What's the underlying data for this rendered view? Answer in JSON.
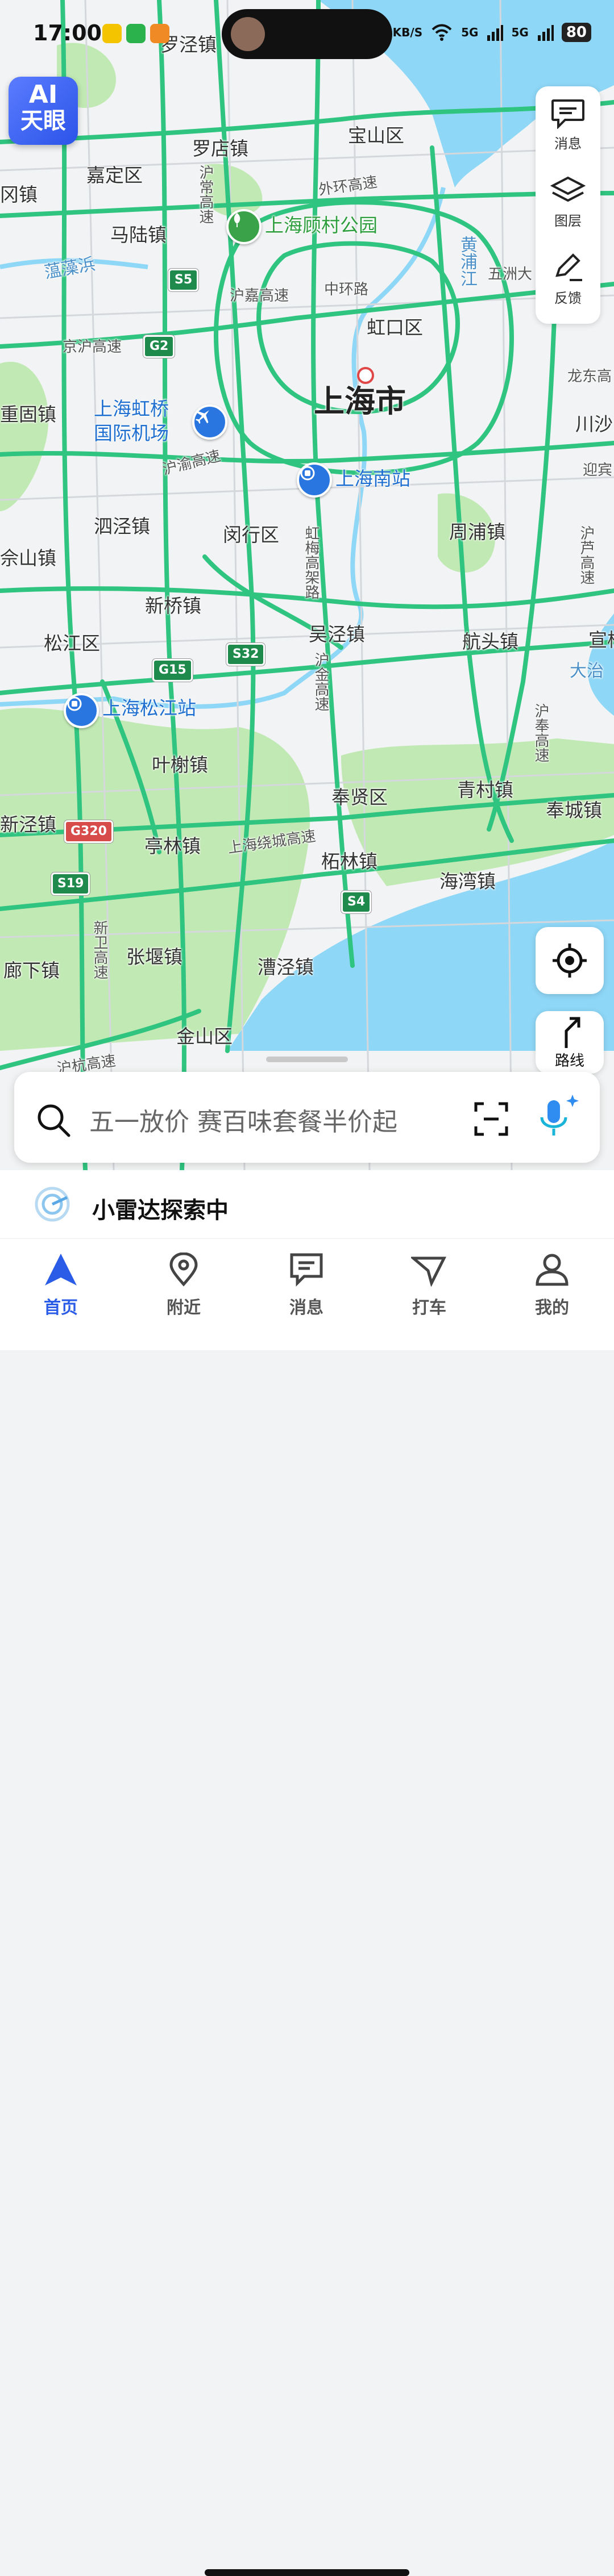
{
  "status_bar": {
    "time": "17:00",
    "speed": "180 KB/S",
    "net1": "5G",
    "net2": "5G",
    "battery": "80"
  },
  "ai_button": {
    "line1": "AI",
    "line2": "天眼"
  },
  "tools": [
    {
      "label": "消息",
      "icon": "message-icon"
    },
    {
      "label": "图层",
      "icon": "layers-icon"
    },
    {
      "label": "反馈",
      "icon": "feedback-icon"
    }
  ],
  "route_button": {
    "label": "路线"
  },
  "map": {
    "city": "上海市",
    "places": {
      "luojing": "罗店镇",
      "baoshan": "宝山区",
      "jiading": "嘉定区",
      "malu": "马陆镇",
      "hongkou": "虹口区",
      "chonggu": "重固镇",
      "sijing": "泗泾镇",
      "minhang": "闵行区",
      "zhoupu": "周浦镇",
      "xinqiao": "新桥镇",
      "songjiang": "松江区",
      "wujing": "吴泾镇",
      "hangtou": "航头镇",
      "yeshie": "叶榭镇",
      "fengxian": "奉贤区",
      "qingcun": "青村镇",
      "fengcheng": "奉城镇",
      "tinglin": "亭林镇",
      "zhelin": "柘林镇",
      "haiwan": "海湾镇",
      "zhangyan": "张堰镇",
      "caojing": "漕泾镇",
      "jinshan": "金山区",
      "langxia": "廊下镇",
      "luojingtop": "罗泾镇",
      "sheshan": "佘山镇",
      "xinjing": "新泾镇",
      "weizhen": "冈镇",
      "chuansha": "川沙",
      "xuanqiao": "宣桥",
      "donghai": "大治"
    },
    "pois": {
      "hongqiao": "上海虹桥国际机场",
      "hongqiao_l1": "上海虹桥",
      "hongqiao_l2": "国际机场",
      "south": "上海南站",
      "songjiang_st": "上海松江站",
      "gucun": "上海顾村公园"
    },
    "roads": {
      "outer_ring": "外环高速",
      "middle_ring": "中环路",
      "hujia": "沪嘉高速",
      "jinghu": "京沪高速",
      "huyu": "沪渝高速",
      "huchang": "沪常高速",
      "hongmei": "虹梅高架路",
      "hujin": "沪金高速",
      "huan": "上海绕城高速",
      "xinwei": "新卫高速",
      "hulu": "沪芦高速",
      "lidong": "龙东高",
      "yingbin": "迎宾",
      "huqi": "沪奉高速",
      "wuzhou": "五洲大",
      "huzhu": "沪杭高速"
    },
    "water": {
      "huangpu": "黄浦江",
      "yunzao": "蕰藻浜"
    },
    "shields": {
      "s5": "S5",
      "g2": "G2",
      "g15": "G15",
      "s32": "S32",
      "g320": "G320",
      "s19": "S19",
      "s4": "S4"
    }
  },
  "search": {
    "placeholder": "五一放价 赛百味套餐半价起"
  },
  "radar": {
    "text": "小雷达探索中"
  },
  "tabs": [
    {
      "label": "首页",
      "active": true
    },
    {
      "label": "附近",
      "active": false
    },
    {
      "label": "消息",
      "active": false
    },
    {
      "label": "打车",
      "active": false
    },
    {
      "label": "我的",
      "active": false
    }
  ]
}
